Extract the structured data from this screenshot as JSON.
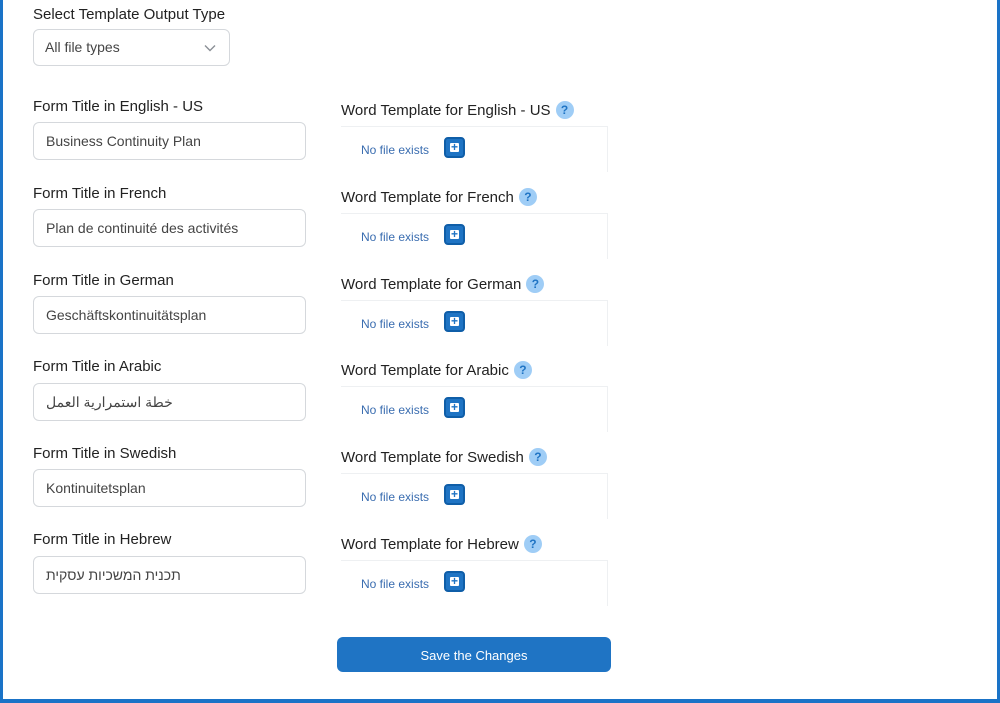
{
  "output_type": {
    "label": "Select Template Output Type",
    "value": "All file types",
    "icon": "chevron-down-icon"
  },
  "rows": [
    {
      "title_label": "Form Title in English - US",
      "title_value": "Business Continuity Plan",
      "word_label": "Word Template for English - US",
      "file_status": "No file exists"
    },
    {
      "title_label": "Form Title in French",
      "title_value": "Plan de continuité des activités",
      "word_label": "Word Template for French",
      "file_status": "No file exists"
    },
    {
      "title_label": "Form Title in German",
      "title_value": "Geschäftskontinuitätsplan",
      "word_label": "Word Template for German",
      "file_status": "No file exists"
    },
    {
      "title_label": "Form Title in Arabic",
      "title_value": "خطة استمرارية العمل",
      "word_label": "Word Template for Arabic",
      "file_status": "No file exists"
    },
    {
      "title_label": "Form Title in Swedish",
      "title_value": "Kontinuitetsplan",
      "word_label": "Word Template for Swedish",
      "file_status": "No file exists"
    },
    {
      "title_label": "Form Title in Hebrew",
      "title_value": "תכנית המשכיות עסקית",
      "word_label": "Word Template for Hebrew",
      "file_status": "No file exists"
    }
  ],
  "help_glyph": "?",
  "add_glyph": "+",
  "save_label": "Save the Changes",
  "colors": {
    "accent": "#1f74c4",
    "help_bg": "#9fcdf6",
    "border": "#1a73c7"
  }
}
